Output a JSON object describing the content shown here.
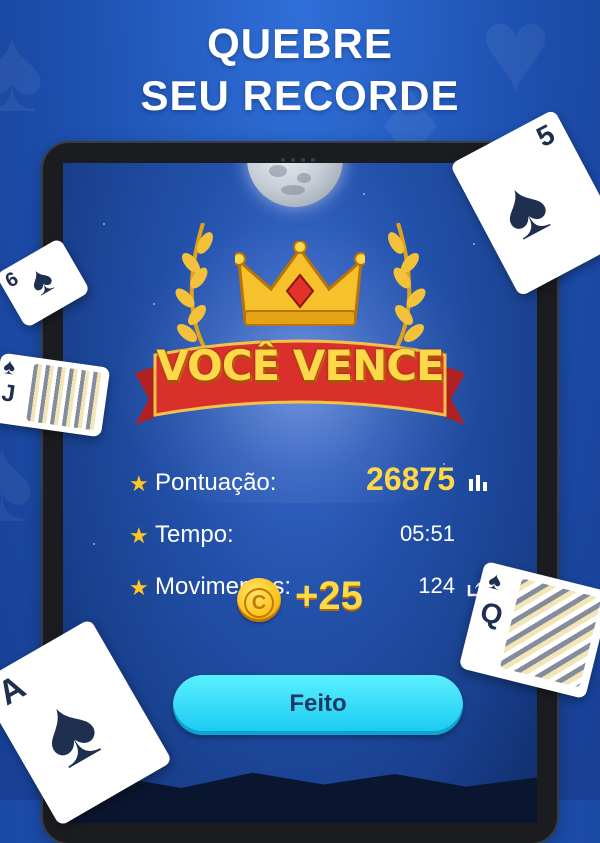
{
  "headline": {
    "line1": "QUEBRE",
    "line2": "SEU RECORDE"
  },
  "game": {
    "title": "VOCÊ VENCE",
    "stats": [
      {
        "label": "Pontuação:",
        "value": "26875",
        "icon": "leaderboard-icon"
      },
      {
        "label": "Tempo:",
        "value": "05:51",
        "icon": ""
      },
      {
        "label": "Movimentos:",
        "value": "124",
        "icon": "share-icon"
      }
    ],
    "reward": {
      "amount": "+25",
      "coin_letter": "C"
    },
    "done_button": "Feito"
  },
  "cards": [
    {
      "rank": "5",
      "suit": "♠"
    },
    {
      "rank": "A",
      "suit": "♠"
    },
    {
      "rank": "6",
      "suit": "♠"
    },
    {
      "rank": "J",
      "suit": "♠"
    },
    {
      "rank": "Q",
      "suit": "♠"
    }
  ],
  "colors": {
    "accent": "#ffd84a",
    "button": "#19c9f0",
    "background": "#1d4fae"
  }
}
